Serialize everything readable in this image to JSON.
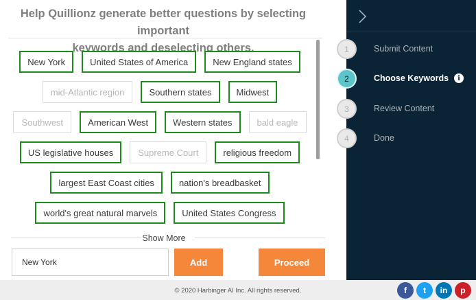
{
  "heading": {
    "line1": "Help Quillionz generate better questions by selecting important",
    "line2": "keywords and deselecting others."
  },
  "keyword_rows": [
    [
      {
        "label": "New York",
        "selected": true
      },
      {
        "label": "United States of America",
        "selected": true
      },
      {
        "label": "New England states",
        "selected": true
      }
    ],
    [
      {
        "label": "mid-Atlantic region",
        "selected": false
      },
      {
        "label": "Southern states",
        "selected": true
      },
      {
        "label": "Midwest",
        "selected": true
      }
    ],
    [
      {
        "label": "Southwest",
        "selected": false
      },
      {
        "label": "American West",
        "selected": true
      },
      {
        "label": "Western states",
        "selected": true
      },
      {
        "label": "bald eagle",
        "selected": false
      }
    ],
    [
      {
        "label": "US legislative houses",
        "selected": true
      },
      {
        "label": "Supreme Court",
        "selected": false
      },
      {
        "label": "religious freedom",
        "selected": true
      }
    ],
    [
      {
        "label": "largest East Coast cities",
        "selected": true
      },
      {
        "label": "nation's breadbasket",
        "selected": true
      }
    ],
    [
      {
        "label": "world's great natural marvels",
        "selected": true
      },
      {
        "label": "United States Congress",
        "selected": true
      }
    ]
  ],
  "show_more": "Show More",
  "keyword_input": {
    "value": "New York",
    "placeholder": ""
  },
  "buttons": {
    "add": "Add",
    "proceed": "Proceed"
  },
  "sidebar": {
    "collapse_icon": "chevron-right-icon",
    "steps": [
      {
        "number": "1",
        "label": "Submit Content",
        "active": false
      },
      {
        "number": "2",
        "label": "Choose Keywords",
        "active": true
      },
      {
        "number": "3",
        "label": "Review Content",
        "active": false
      },
      {
        "number": "4",
        "label": "Done",
        "active": false
      }
    ],
    "info_icon": "i"
  },
  "footer": {
    "copyright": "© 2020 Harbinger AI Inc. All rights reserved.",
    "social": [
      {
        "name": "facebook-icon",
        "glyph": "f",
        "color": "#3b5998"
      },
      {
        "name": "twitter-icon",
        "glyph": "t",
        "color": "#1da1f2"
      },
      {
        "name": "linkedin-icon",
        "glyph": "in",
        "color": "#0077b5"
      },
      {
        "name": "pinterest-icon",
        "glyph": "p",
        "color": "#cb2027"
      }
    ]
  },
  "colors": {
    "chip_selected_border": "#1e8a1e",
    "button_orange": "#f4873a",
    "sidebar_bg": "#0a2436",
    "active_step": "#5dc5c9"
  }
}
